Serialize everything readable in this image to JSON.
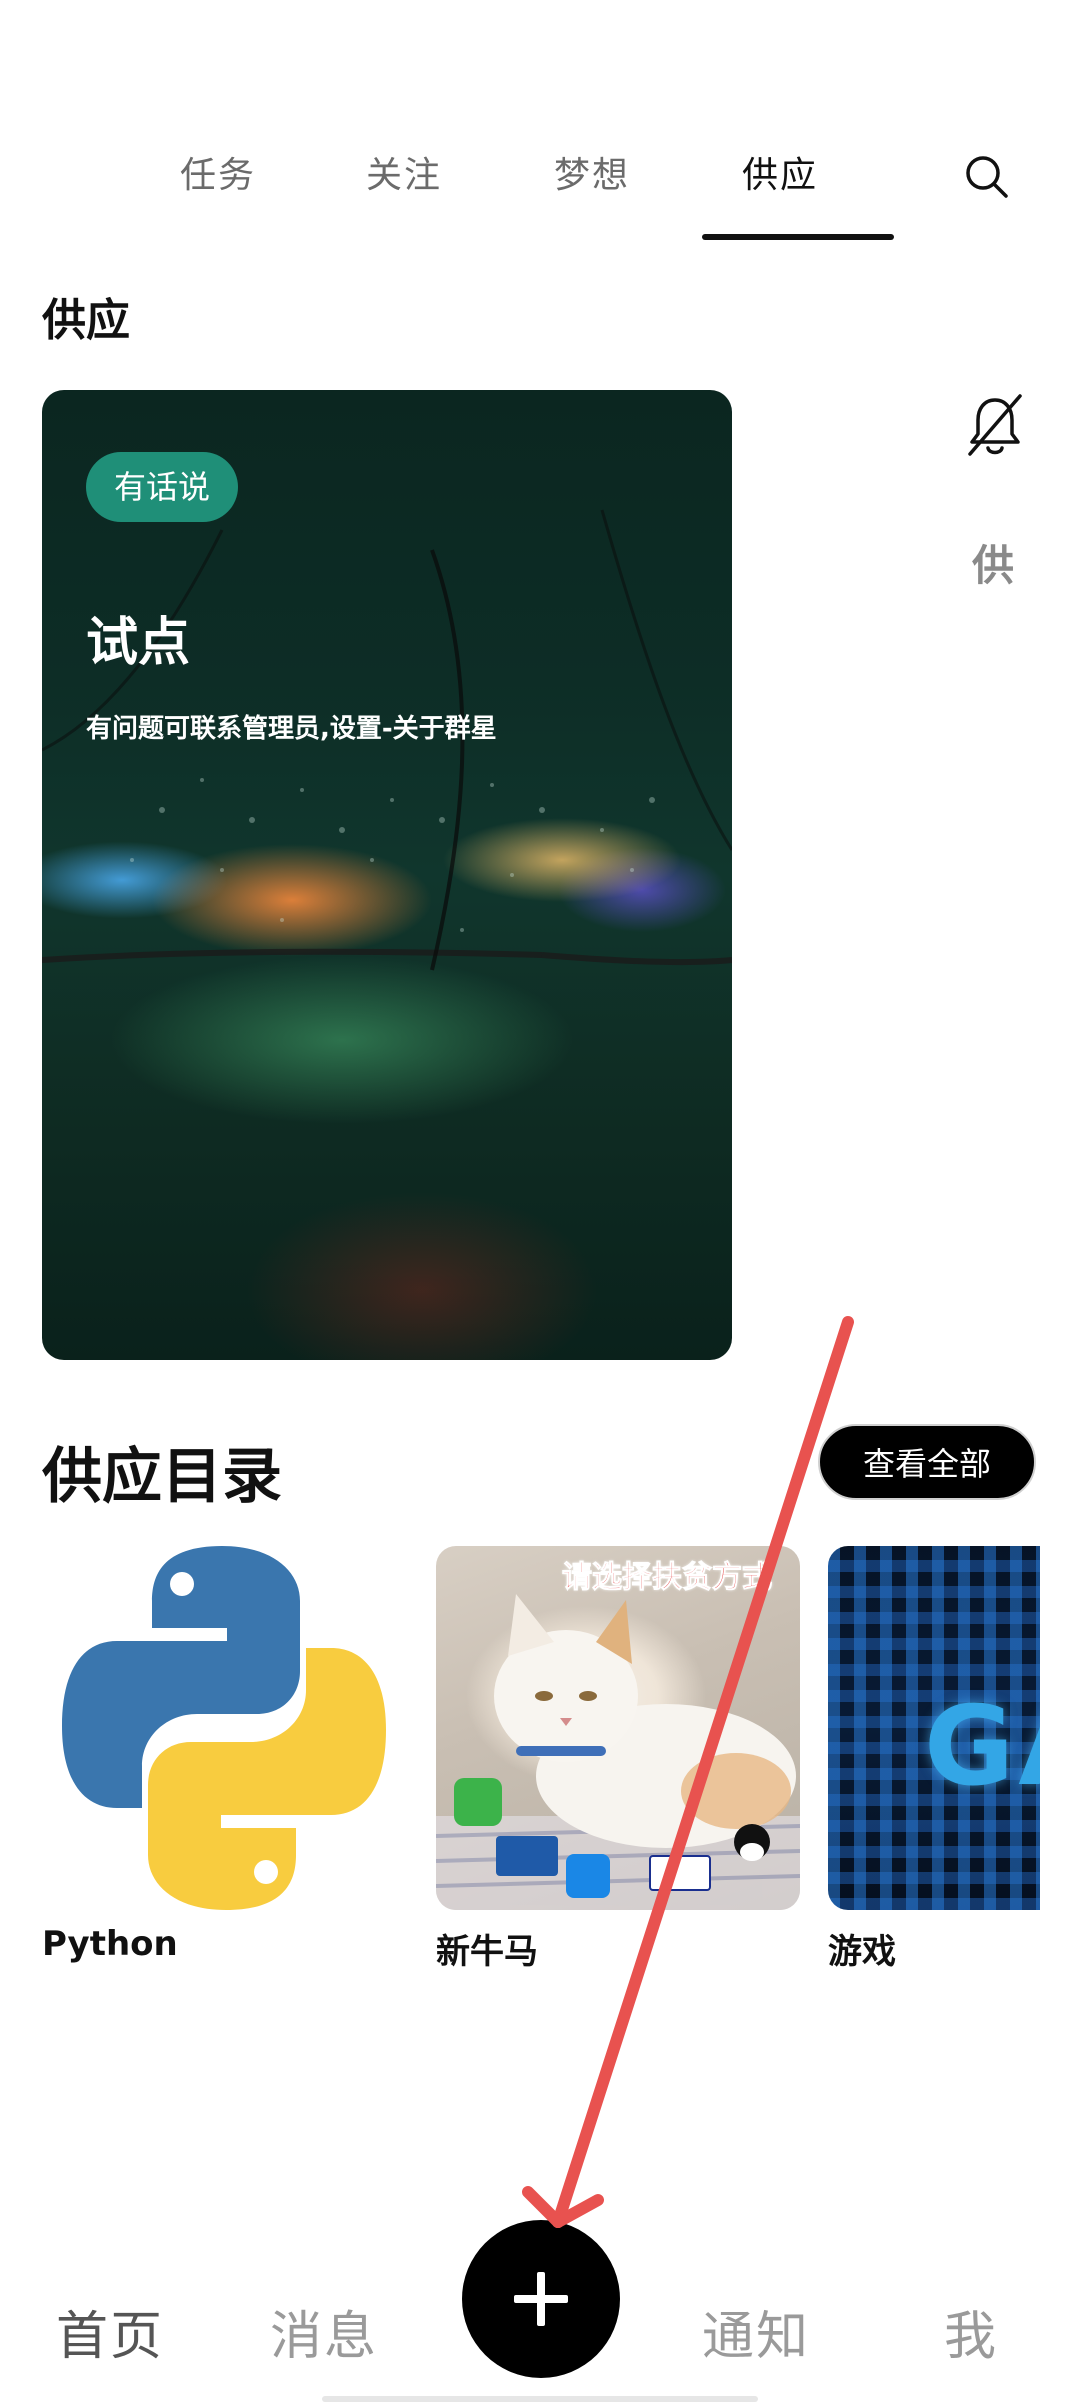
{
  "tabs": [
    {
      "label": "任务",
      "active": false
    },
    {
      "label": "关注",
      "active": false
    },
    {
      "label": "梦想",
      "active": false
    },
    {
      "label": "供应",
      "active": true
    }
  ],
  "search_icon": "search-icon",
  "section": {
    "title": "供应"
  },
  "hero": {
    "badge": "有话说",
    "title": "试点",
    "subtitle": "有问题可联系管理员,设置-关于群星"
  },
  "side_peek": {
    "bell_icon": "bell-off-icon",
    "text": "供"
  },
  "catalog": {
    "title": "供应目录",
    "view_all": "查看全部",
    "items": [
      {
        "label": "Python",
        "icon": "python-logo"
      },
      {
        "label": "新牛马",
        "banner": "请选择扶贫方式"
      },
      {
        "label": "游戏",
        "cover_text": "GAM"
      }
    ]
  },
  "bottom_nav": {
    "items": [
      {
        "label": "首页",
        "active": true
      },
      {
        "label": "消息",
        "active": false
      },
      {
        "label": "通知",
        "active": false
      },
      {
        "label": "我",
        "active": false
      }
    ],
    "fab_icon": "plus-icon"
  },
  "colors": {
    "badge": "#1f8f78",
    "annotation_arrow": "#e8524f",
    "fab": "#000000"
  }
}
